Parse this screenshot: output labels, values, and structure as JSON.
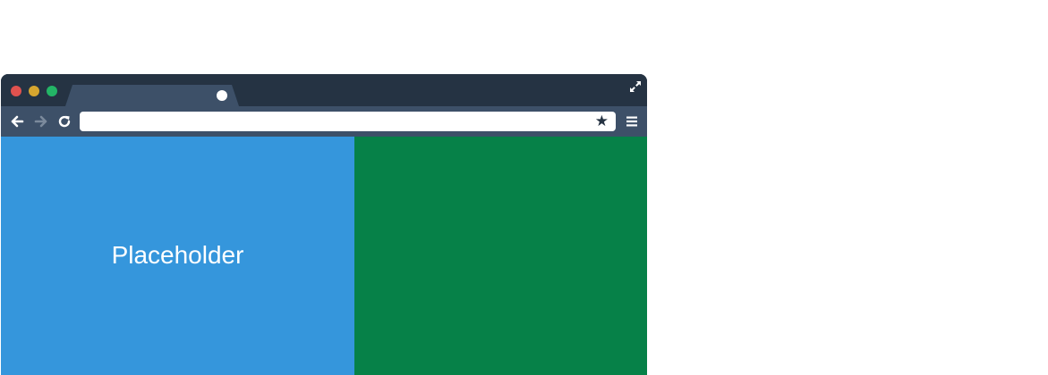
{
  "window": {
    "controls": [
      "close",
      "minimize",
      "maximize"
    ],
    "expand_icon": "expand-icon"
  },
  "tab": {
    "indicator_icon": "circle-icon"
  },
  "toolbar": {
    "back_icon": "back-arrow-icon",
    "forward_icon": "forward-arrow-icon",
    "reload_icon": "reload-icon",
    "address_value": "",
    "bookmark_icon": "star-icon",
    "bookmark_glyph": "★",
    "menu_icon": "hamburger-menu-icon"
  },
  "content": {
    "left_label": "Placeholder",
    "left_color": "#3596dc",
    "right_color": "#068148"
  }
}
